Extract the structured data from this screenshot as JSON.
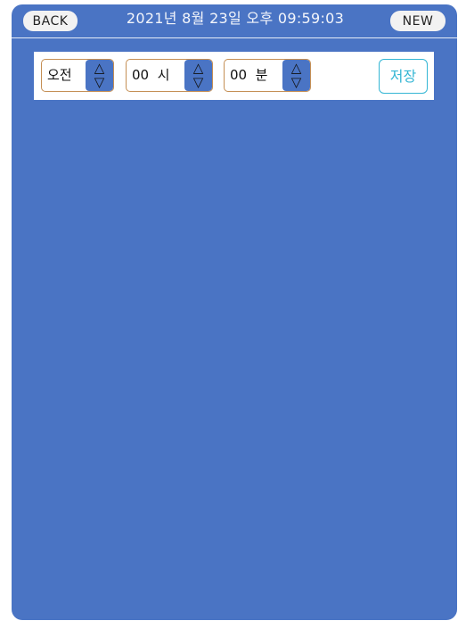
{
  "header": {
    "back_label": "BACK",
    "new_label": "NEW",
    "datetime": "2021년 8월 23일 오후 09:59:03"
  },
  "time_picker": {
    "ampm": {
      "value": "오전",
      "up_icon": "△",
      "down_icon": "▽"
    },
    "hour": {
      "value": "00  시",
      "up_icon": "△",
      "down_icon": "▽"
    },
    "minute": {
      "value": "00  분",
      "up_icon": "△",
      "down_icon": "▽"
    },
    "save_label": "저장"
  },
  "colors": {
    "background": "#4a74c4",
    "spinner_border": "#c58f55",
    "save_accent": "#34b6d4"
  }
}
